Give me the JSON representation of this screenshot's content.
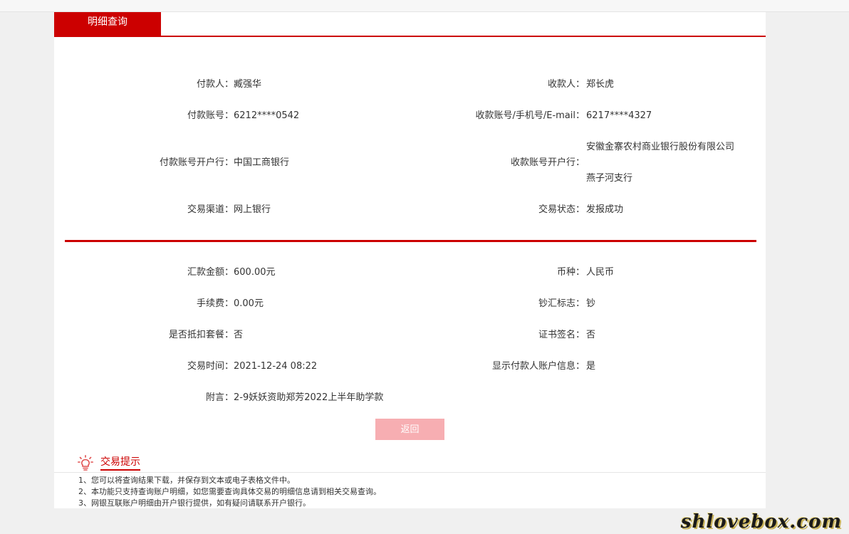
{
  "tab": {
    "title": "明细查询"
  },
  "section1": [
    {
      "left_label": "付款人：",
      "left_value": "臧强华",
      "right_label": "收款人：",
      "right_value": "郑长虎"
    },
    {
      "left_label": "付款账号：",
      "left_value": "6212****0542",
      "right_label": "收款账号/手机号/E-mail：",
      "right_value": "6217****4327"
    },
    {
      "left_label": "付款账号开户行：",
      "left_value": "中国工商银行",
      "right_label": "收款账号开户行：",
      "right_value_line1": "安徽金寨农村商业银行股份有限公司",
      "right_value_line2": "燕子河支行"
    },
    {
      "left_label": "交易渠道：",
      "left_value": "网上银行",
      "right_label": "交易状态：",
      "right_value": "发报成功"
    }
  ],
  "section2": [
    {
      "left_label": "汇款金额：",
      "left_value": "600.00元",
      "right_label": "币种：",
      "right_value": "人民币"
    },
    {
      "left_label": "手续费：",
      "left_value": "0.00元",
      "right_label": "钞汇标志：",
      "right_value": "钞"
    },
    {
      "left_label": "是否抵扣套餐：",
      "left_value": "否",
      "right_label": "证书签名：",
      "right_value": "否"
    },
    {
      "left_label": "交易时间：",
      "left_value": "2021-12-24 08:22",
      "right_label": "显示付款人账户信息：",
      "right_value": "是"
    },
    {
      "left_label": "附言：",
      "left_value": "2-9妖妖资助郑芳2022上半年助学款"
    }
  ],
  "back_button": "返回",
  "tips": {
    "title": "交易提示",
    "items": [
      "1、您可以将查询结果下载，并保存到文本或电子表格文件中。",
      "2、本功能只支持查询账户明细，如您需要查询具体交易的明细信息请到相关交易查询。",
      "3、网银互联账户明细由开户银行提供，如有疑问请联系开户银行。"
    ]
  },
  "watermark": "shlovebox.com",
  "colors": {
    "accent": "#cc0000",
    "button_disabled": "#f7aeb2"
  }
}
